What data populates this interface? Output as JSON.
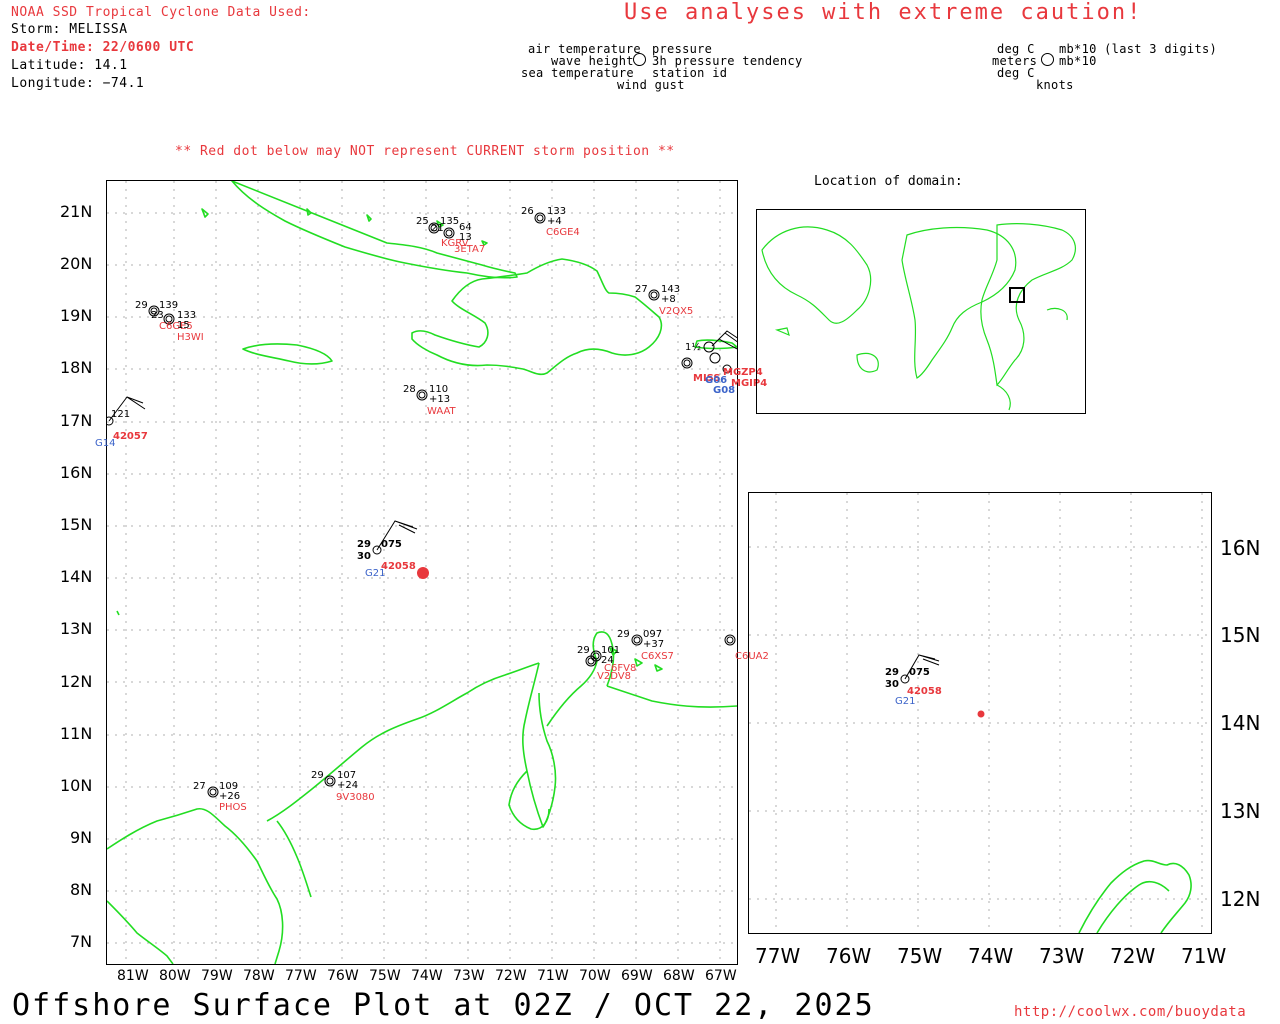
{
  "header": {
    "source": "NOAA SSD Tropical Cyclone Data Used:",
    "storm": "Storm: MELISSA",
    "datetime": "Date/Time: 22/0600 UTC",
    "latitude": "Latitude: 14.1",
    "longitude": "Longitude: −74.1",
    "caution": "Use analyses with extreme caution!",
    "red_dot_note": "** Red dot below may NOT represent CURRENT storm position **"
  },
  "legend": {
    "left_labels": [
      "air temperature",
      "wave height",
      "sea temperature"
    ],
    "right_labels": [
      "pressure",
      "3h pressure tendency",
      "station id"
    ],
    "bottom_label": "wind gust",
    "units_left": [
      "deg C",
      "meters",
      "deg C"
    ],
    "units_right": [
      "mb*10 (last 3 digits)",
      "mb*10"
    ],
    "units_bottom": "knots"
  },
  "inset": {
    "title": "Location of domain:"
  },
  "main_map": {
    "lat_ticks": [
      "21N",
      "20N",
      "19N",
      "18N",
      "17N",
      "16N",
      "15N",
      "14N",
      "13N",
      "12N",
      "11N",
      "10N",
      "9N",
      "8N",
      "7N"
    ],
    "lon_ticks": [
      "81W",
      "80W",
      "79W",
      "78W",
      "77W",
      "76W",
      "75W",
      "74W",
      "73W",
      "72W",
      "71W",
      "70W",
      "69W",
      "68W",
      "67W"
    ],
    "stations": [
      {
        "id": "C6GE4",
        "top": "26",
        "right": "133",
        "tend": "+4"
      },
      {
        "id": "KGRV",
        "top": "25",
        "right": "135",
        "tend": ""
      },
      {
        "id": "3ETA7",
        "top": "21",
        "right": "64",
        "tend": "13"
      },
      {
        "id": "C6GE5",
        "top": "29",
        "right": "139",
        "tend": "23"
      },
      {
        "id": "H3WI",
        "top": "",
        "right": "133",
        "tend": "15"
      },
      {
        "id": "V2QX5",
        "top": "27",
        "right": "143",
        "tend": "+8"
      },
      {
        "id": "WAAT",
        "top": "28",
        "right": "110",
        "tend": "+13"
      },
      {
        "id": "42057",
        "top": "",
        "right": "121",
        "tend": ""
      },
      {
        "id": "G14",
        "top": "",
        "right": "",
        "tend": ""
      },
      {
        "id": "42058",
        "top": "29",
        "right": "075",
        "tend": "30"
      },
      {
        "id": "G21",
        "top": "",
        "right": "",
        "tend": ""
      },
      {
        "id": "C6XS7",
        "top": "29",
        "right": "097",
        "tend": "+37"
      },
      {
        "id": "C6UA2",
        "top": "",
        "right": "",
        "tend": ""
      },
      {
        "id": "V2DV8",
        "top": "29",
        "right": "101",
        "tend": "24"
      },
      {
        "id": "C6FV8",
        "top": "29",
        "right": "101",
        "tend": ""
      },
      {
        "id": "PHOS",
        "top": "27",
        "right": "109",
        "tend": "+26"
      },
      {
        "id": "9V3080",
        "top": "29",
        "right": "107",
        "tend": "+24"
      },
      {
        "id": "MISS",
        "top": "1½",
        "right": "",
        "tend": ""
      },
      {
        "id": "MGZP4",
        "top": "",
        "right": "",
        "tend": ""
      },
      {
        "id": "MGIP4",
        "top": "",
        "right": "",
        "tend": ""
      },
      {
        "id": "G06",
        "top": "",
        "right": "",
        "tend": ""
      },
      {
        "id": "G08",
        "top": "",
        "right": "",
        "tend": ""
      }
    ]
  },
  "zoom_map": {
    "lat_ticks": [
      "16N",
      "15N",
      "14N",
      "13N",
      "12N"
    ],
    "lon_ticks": [
      "77W",
      "76W",
      "75W",
      "74W",
      "73W",
      "72W",
      "71W"
    ],
    "station": {
      "id": "42058",
      "top": "29",
      "right": "075",
      "tend": "30",
      "sat": "G21"
    }
  },
  "footer": {
    "title": "Offshore Surface Plot at 02Z / OCT 22, 2025",
    "url": "http://coolwx.com/buoydata"
  },
  "colors": {
    "coast": "#22dd22",
    "red": "#e8383d",
    "blue": "#3b63c9",
    "grid": "#b0b0b0"
  }
}
